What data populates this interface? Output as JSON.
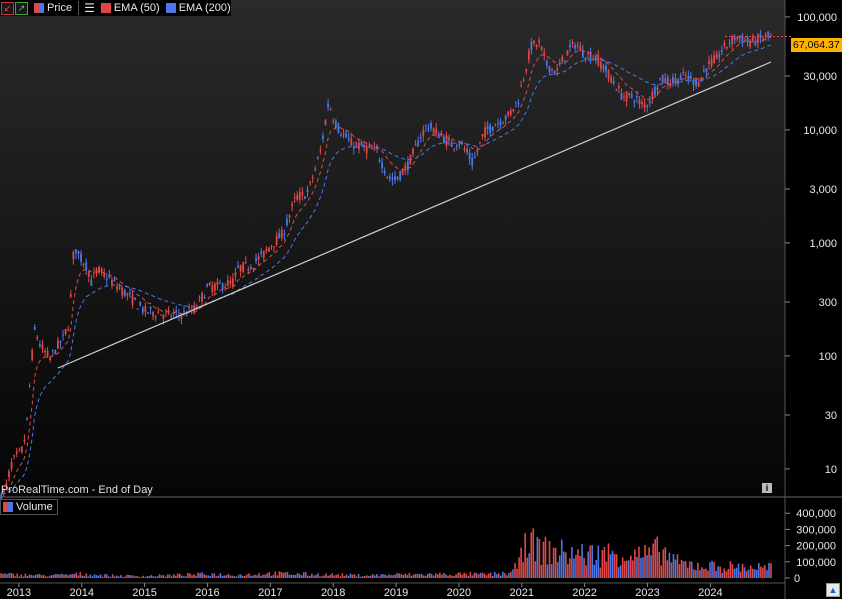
{
  "toolbar": {
    "price_label": "Price",
    "ema50_label": "EMA (50)",
    "ema200_label": "EMA (200)"
  },
  "volume_label": "Volume",
  "source_label": "ProRealTime.com - End of Day",
  "last_price_tag": "67,064.37",
  "colors": {
    "up": "#4a78e8",
    "down": "#e04848",
    "ema50": "#e04848",
    "ema200": "#4a78e8",
    "trendline": "#cfcfcf",
    "price_tag": "#ffb300"
  },
  "icons": {
    "info": "info-icon",
    "corner": "scroll-up-icon"
  },
  "chart_data": [
    {
      "type": "line",
      "series_kind": "candlestick-like price series (log scale)",
      "yscale": "log",
      "ylim": [
        6,
        130000
      ],
      "xlim": [
        2012.7,
        2024.98
      ],
      "ytick_labels": [
        "100,000",
        "30,000",
        "10,000",
        "3,000",
        "1,000",
        "300",
        "100",
        "30",
        "10"
      ],
      "ytick_values": [
        100000,
        30000,
        10000,
        3000,
        1000,
        300,
        100,
        30,
        10
      ],
      "xtick_labels": [
        "2013",
        "2014",
        "2015",
        "2016",
        "2017",
        "2018",
        "2019",
        "2020",
        "2021",
        "2022",
        "2023",
        "2024"
      ],
      "xtick_values": [
        2013,
        2014,
        2015,
        2016,
        2017,
        2018,
        2019,
        2020,
        2021,
        2022,
        2023,
        2024
      ],
      "price_x": [
        2012.72,
        2012.8,
        2012.88,
        2012.96,
        2013.04,
        2013.12,
        2013.2,
        2013.26,
        2013.32,
        2013.4,
        2013.5,
        2013.6,
        2013.7,
        2013.8,
        2013.88,
        2013.93,
        2014.02,
        2014.1,
        2014.15,
        2014.25,
        2014.4,
        2014.6,
        2014.8,
        2015.0,
        2015.2,
        2015.4,
        2015.6,
        2015.8,
        2016.0,
        2016.2,
        2016.4,
        2016.5,
        2016.7,
        2016.9,
        2017.0,
        2017.2,
        2017.4,
        2017.6,
        2017.8,
        2017.93,
        2018.0,
        2018.1,
        2018.3,
        2018.5,
        2018.7,
        2018.88,
        2019.0,
        2019.2,
        2019.4,
        2019.5,
        2019.7,
        2019.9,
        2020.0,
        2020.15,
        2020.22,
        2020.4,
        2020.6,
        2020.8,
        2020.95,
        2021.05,
        2021.15,
        2021.28,
        2021.4,
        2021.55,
        2021.7,
        2021.85,
        2022.0,
        2022.2,
        2022.4,
        2022.6,
        2022.8,
        2022.9,
        2023.0,
        2023.2,
        2023.4,
        2023.6,
        2023.8,
        2023.95,
        2024.1,
        2024.2,
        2024.4,
        2024.6,
        2024.8,
        2024.9
      ],
      "price_y": [
        5.5,
        7,
        11,
        13,
        14,
        22,
        90,
        180,
        130,
        110,
        95,
        120,
        140,
        200,
        1000,
        800,
        700,
        600,
        450,
        580,
        500,
        400,
        320,
        250,
        240,
        230,
        235,
        260,
        400,
        420,
        450,
        600,
        640,
        800,
        950,
        1200,
        2500,
        2800,
        6500,
        18000,
        13000,
        10000,
        7500,
        7000,
        6400,
        3800,
        3600,
        5000,
        9000,
        11000,
        9000,
        7300,
        8000,
        6000,
        5000,
        9500,
        11500,
        13500,
        19000,
        33000,
        55000,
        58000,
        38000,
        32000,
        47000,
        58000,
        47000,
        43000,
        30000,
        20000,
        19500,
        16800,
        17000,
        28000,
        27000,
        30000,
        26000,
        37000,
        43000,
        52000,
        67000,
        60000,
        64000,
        67064
      ]
    },
    {
      "type": "bar",
      "title": "Volume",
      "ytick_labels": [
        "400,000",
        "300,000",
        "200,000",
        "100,000",
        "0"
      ],
      "ytick_values": [
        400000,
        300000,
        200000,
        100000,
        0
      ],
      "ylim": [
        0,
        420000
      ],
      "x": [
        2013,
        2013.5,
        2014,
        2014.5,
        2015,
        2015.5,
        2016,
        2016.5,
        2017,
        2017.5,
        2018,
        2018.5,
        2019,
        2019.5,
        2020,
        2020.5,
        2020.85,
        2021.0,
        2021.05,
        2021.2,
        2021.5,
        2022,
        2022.5,
        2023,
        2023.2,
        2023.5,
        2024,
        2024.5,
        2024.9
      ],
      "values": [
        25000,
        20000,
        30000,
        18000,
        15000,
        22000,
        30000,
        24000,
        35000,
        30000,
        25000,
        20000,
        26000,
        28000,
        30000,
        28000,
        40000,
        160000,
        390000,
        230000,
        200000,
        180000,
        190000,
        170000,
        220000,
        110000,
        90000,
        85000,
        80000
      ]
    }
  ]
}
